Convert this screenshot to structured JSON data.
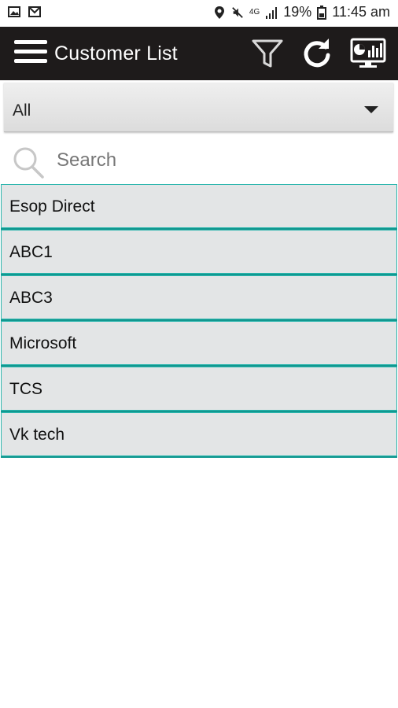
{
  "status_bar": {
    "battery": "19%",
    "time": "11:45 am",
    "network": "4G"
  },
  "app_bar": {
    "title": "Customer List",
    "icons": [
      "menu-icon",
      "filter-icon",
      "refresh-icon",
      "dashboard-icon"
    ]
  },
  "filter_dropdown": {
    "selected": "All"
  },
  "search": {
    "placeholder": "Search",
    "value": ""
  },
  "customers": [
    "Esop Direct",
    "ABC1",
    "ABC3",
    "Microsoft",
    "TCS",
    "Vk tech"
  ],
  "colors": {
    "app_bar_bg": "#1e1b1b",
    "list_item_bg": "#e3e5e6",
    "list_border": "#2bb5ad"
  }
}
